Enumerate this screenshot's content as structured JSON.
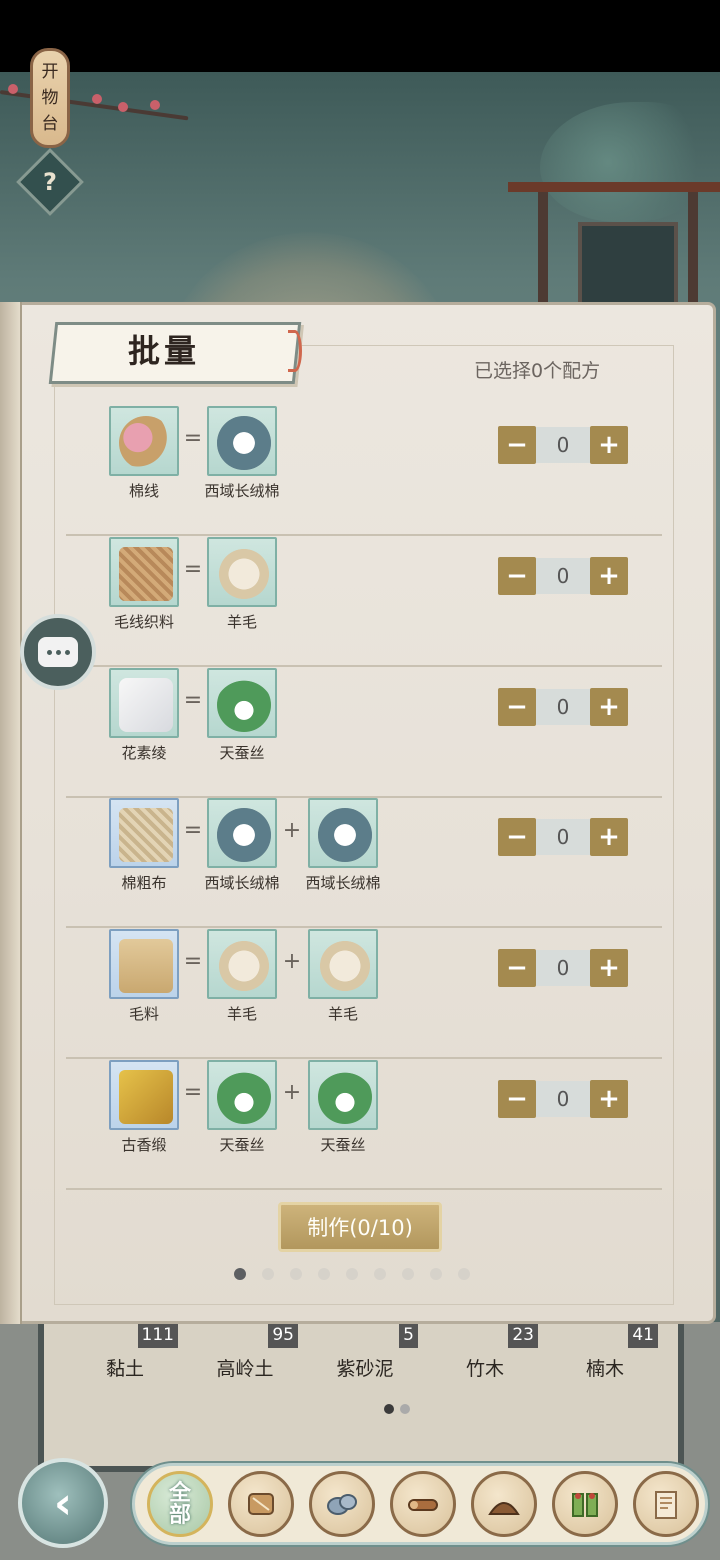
{
  "sign": {
    "chars": [
      "开",
      "物",
      "台"
    ],
    "help": "?"
  },
  "panel": {
    "title": "批量",
    "selected_count": "已选择0个配方",
    "make_button": "制作(0/10)"
  },
  "recipes": [
    {
      "output": "棉线",
      "output_color": "teal",
      "inputs": [
        "西域长绒棉"
      ],
      "value": "0"
    },
    {
      "output": "毛线织料",
      "output_color": "teal",
      "inputs": [
        "羊毛"
      ],
      "value": "0"
    },
    {
      "output": "花素绫",
      "output_color": "teal",
      "inputs": [
        "天蚕丝"
      ],
      "value": "0"
    },
    {
      "output": "棉粗布",
      "output_color": "blue",
      "inputs": [
        "西域长绒棉",
        "西域长绒棉"
      ],
      "value": "0"
    },
    {
      "output": "毛料",
      "output_color": "blue",
      "inputs": [
        "羊毛",
        "羊毛"
      ],
      "value": "0"
    },
    {
      "output": "古香缎",
      "output_color": "blue",
      "inputs": [
        "天蚕丝",
        "天蚕丝"
      ],
      "value": "0"
    }
  ],
  "symbols": {
    "equals": "=",
    "plus": "+",
    "minus": "−",
    "add": "+"
  },
  "pagination": {
    "total": 9,
    "current": 1
  },
  "materials": [
    {
      "name": "黏土",
      "count": "111"
    },
    {
      "name": "高岭土",
      "count": "95"
    },
    {
      "name": "紫砂泥",
      "count": "5"
    },
    {
      "name": "竹木",
      "count": "23"
    },
    {
      "name": "楠木",
      "count": "41"
    }
  ],
  "materials_pagination": {
    "total": 2,
    "current": 1
  },
  "bottom_nav": {
    "all_label_top": "全",
    "all_label_bottom": "部",
    "tabs": [
      "fabric-icon",
      "stone-icon",
      "wood-icon",
      "soil-icon",
      "bamboo-icon",
      "paper-icon"
    ]
  },
  "colors": {
    "accent": "#a48a4f",
    "teal_slot": "#b6d7cf",
    "blue_slot": "#bcd3ea"
  }
}
